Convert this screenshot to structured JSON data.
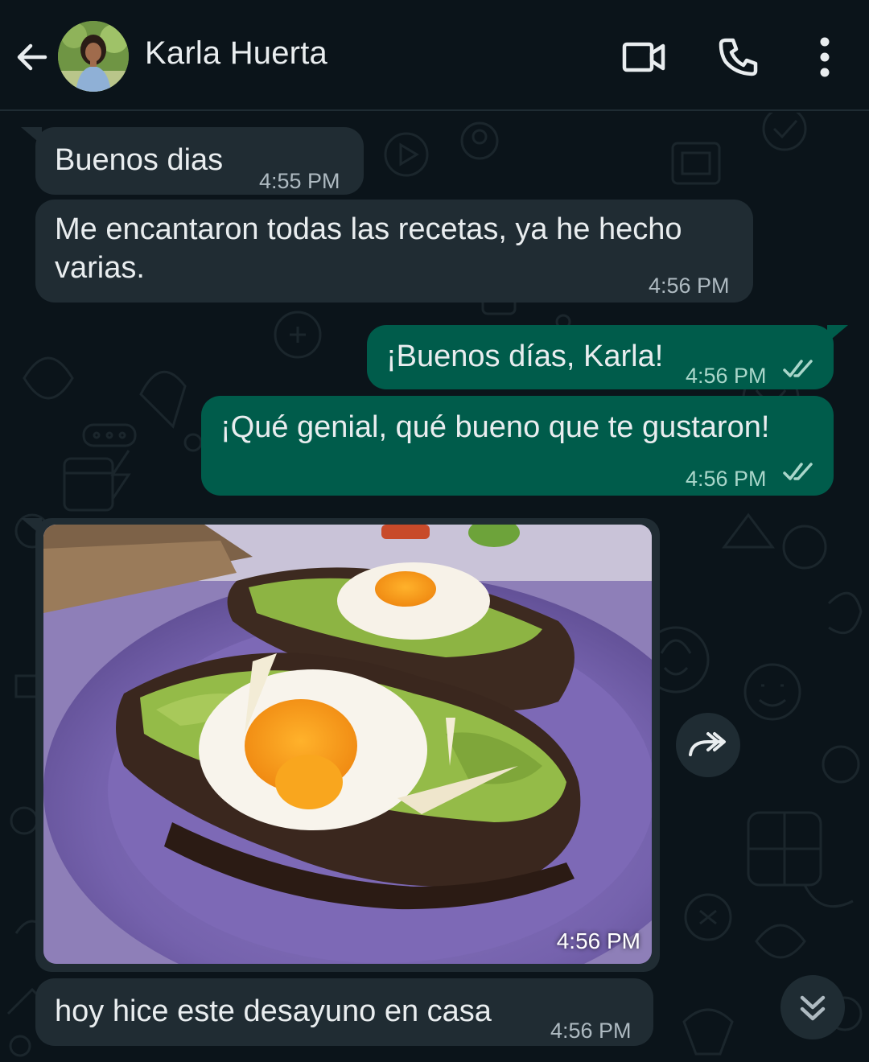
{
  "header": {
    "contact_name": "Karla Huerta",
    "icons": [
      "back-arrow-icon",
      "video-call-icon",
      "phone-icon",
      "more-options-icon"
    ]
  },
  "messages": [
    {
      "direction": "incoming",
      "text": "Buenos dias",
      "time": "4:55 PM"
    },
    {
      "direction": "incoming",
      "text_line1": "Me encantaron todas las recetas, ya he hecho",
      "text_line2": "varias.",
      "time": "4:56 PM"
    },
    {
      "direction": "outgoing",
      "text": "¡Buenos días, Karla!",
      "time": "4:56 PM",
      "status": "read"
    },
    {
      "direction": "outgoing",
      "text": "¡Qué genial, qué bueno que te gustaron!",
      "time": "4:56 PM",
      "status": "read"
    },
    {
      "direction": "incoming",
      "type": "image",
      "time": "4:56 PM"
    },
    {
      "direction": "incoming",
      "text": "hoy hice este desayuno en casa",
      "time": "4:56 PM"
    }
  ],
  "colors": {
    "background": "#0b141a",
    "incoming_bubble": "#202c33",
    "outgoing_bubble": "#005c4b",
    "read_ticks": "#a9d6ca"
  }
}
